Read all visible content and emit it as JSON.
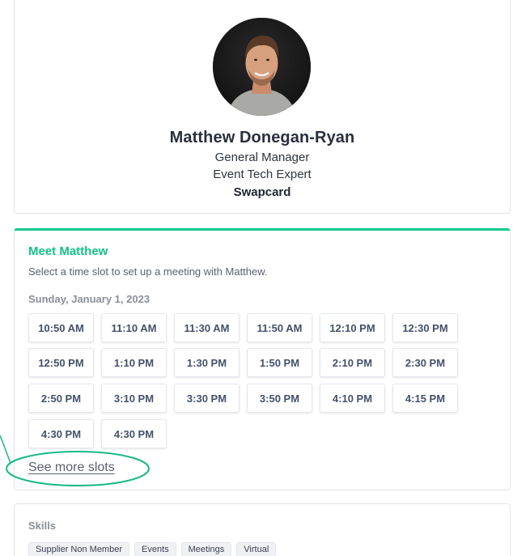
{
  "profile": {
    "name": "Matthew Donegan-Ryan",
    "job_title": "General Manager",
    "subtitle": "Event Tech Expert",
    "company": "Swapcard"
  },
  "meeting": {
    "title": "Meet Matthew",
    "description": "Select a time slot to set up a meeting with Matthew.",
    "date": "Sunday, January 1, 2023",
    "slots": [
      "10:50 AM",
      "11:10 AM",
      "11:30 AM",
      "11:50 AM",
      "12:10 PM",
      "12:30 PM",
      "12:50 PM",
      "1:10 PM",
      "1:30 PM",
      "1:50 PM",
      "2:10 PM",
      "2:30 PM",
      "2:50 PM",
      "3:10 PM",
      "3:30 PM",
      "3:50 PM",
      "4:10 PM",
      "4:15 PM",
      "4:30 PM",
      "4:30 PM"
    ],
    "see_more_label": "See more slots"
  },
  "skills": {
    "title": "Skills",
    "tags": [
      "Supplier Non Member",
      "Events",
      "Meetings",
      "Virtual"
    ]
  },
  "colors": {
    "accent": "#17c98d",
    "annotation": "#17b985"
  }
}
